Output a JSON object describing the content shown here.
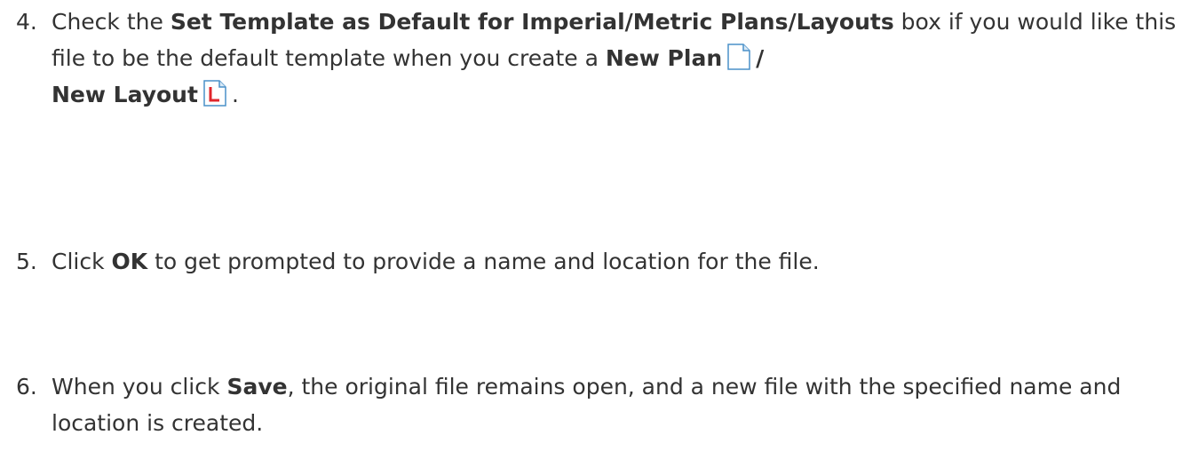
{
  "steps": [
    {
      "number": "4.",
      "segments": {
        "t1": "Check the ",
        "b1": "Set Template as Default for Imperial/Metric Plans/Layouts",
        "t2": " box if you would like this file to be the default template when you create a ",
        "b2": "New Plan",
        "b3": "/",
        "b4": "New Layout",
        "t3": "."
      },
      "icons": [
        "new-plan-icon",
        "new-layout-icon"
      ]
    },
    {
      "number": "5.",
      "segments": {
        "t1": "Click ",
        "b1": "OK",
        "t2": " to get prompted to provide a name and location for the file."
      }
    },
    {
      "number": "6.",
      "segments": {
        "t1": "When you click ",
        "b1": "Save",
        "t2": ", the original file remains open, and a new file with the specified name and location is created."
      }
    }
  ],
  "colors": {
    "text": "#333333",
    "icon_border": "#4a90c8",
    "layout_letter": "#e0252b"
  }
}
